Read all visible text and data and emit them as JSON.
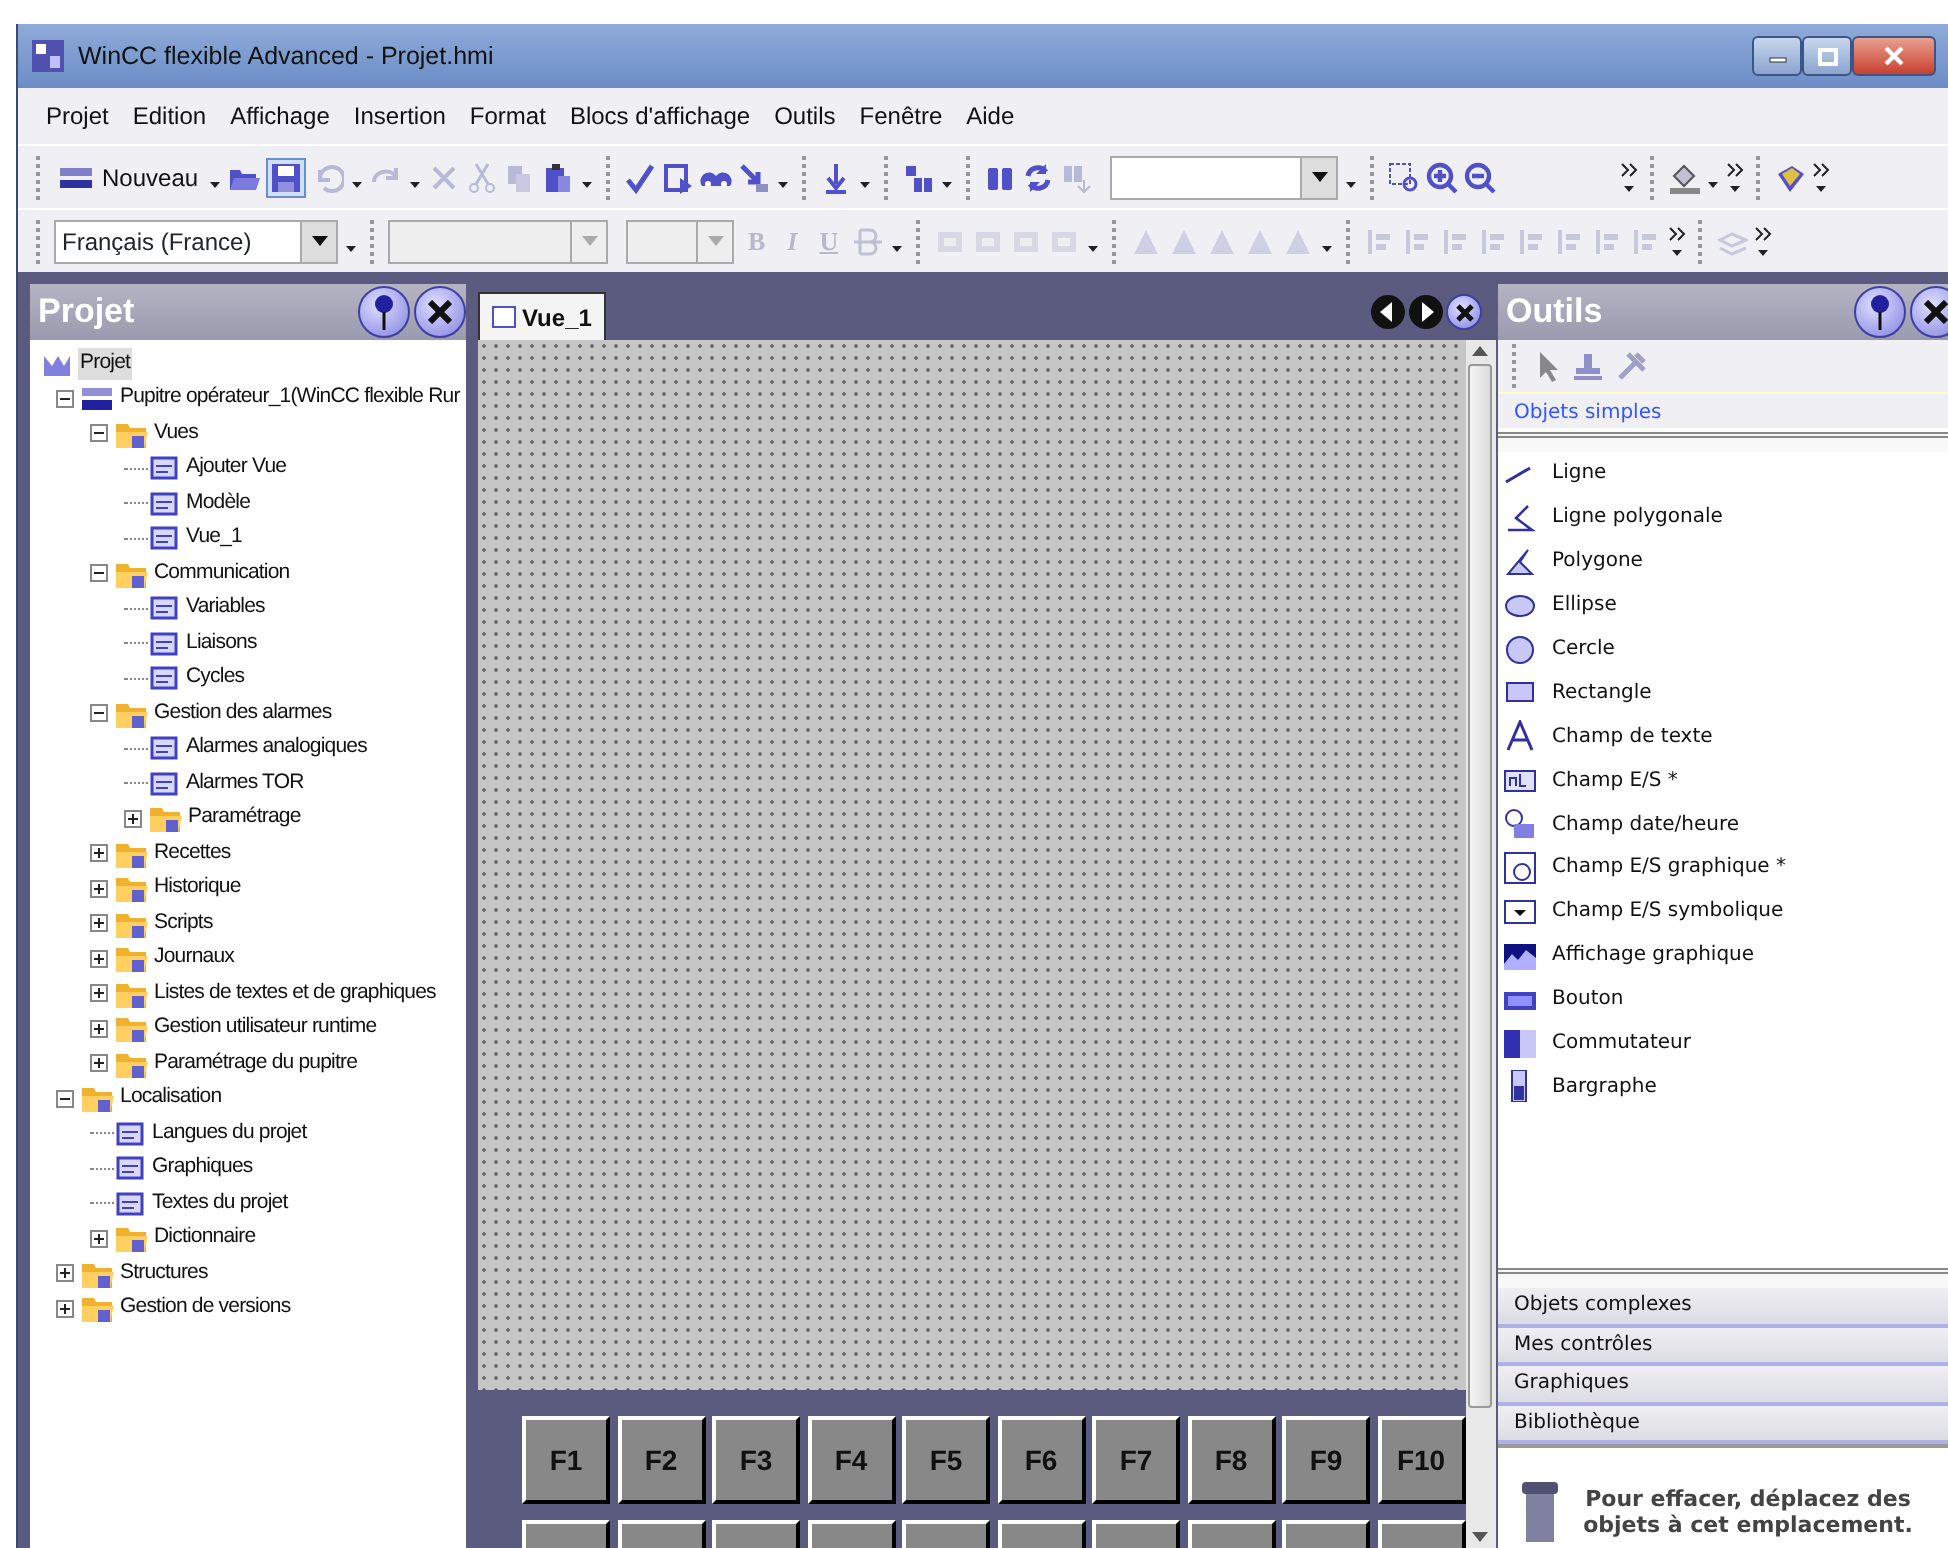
{
  "window": {
    "title": "WinCC flexible Advanced - Projet.hmi"
  },
  "menu": [
    "Projet",
    "Edition",
    "Affichage",
    "Insertion",
    "Format",
    "Blocs d'affichage",
    "Outils",
    "Fenêtre",
    "Aide"
  ],
  "toolbar": {
    "new_button": "Nouveau"
  },
  "format_bar": {
    "language": "Français (France)",
    "style_buttons": [
      "B",
      "I",
      "U"
    ]
  },
  "project_panel": {
    "title": "Projet",
    "tree": [
      {
        "label": "Projet",
        "selected": true,
        "children": [
          {
            "label": "Pupitre opérateur_1(WinCC flexible Rur",
            "selected": false,
            "expanded": true,
            "children": [
              {
                "label": "Vues",
                "selected": false,
                "expanded": true,
                "children": [
                  {
                    "label": "Ajouter Vue",
                    "selected": false
                  },
                  {
                    "label": "Modèle",
                    "selected": false
                  },
                  {
                    "label": "Vue_1",
                    "selected": false
                  }
                ]
              },
              {
                "label": "Communication",
                "selected": false,
                "expanded": true,
                "children": [
                  {
                    "label": "Variables",
                    "selected": false
                  },
                  {
                    "label": "Liaisons",
                    "selected": false
                  },
                  {
                    "label": "Cycles",
                    "selected": false
                  }
                ]
              },
              {
                "label": "Gestion des alarmes",
                "selected": false,
                "expanded": true,
                "children": [
                  {
                    "label": "Alarmes analogiques",
                    "selected": false
                  },
                  {
                    "label": "Alarmes TOR",
                    "selected": false
                  },
                  {
                    "label": "Paramétrage",
                    "selected": false,
                    "expanded": false
                  }
                ]
              },
              {
                "label": "Recettes",
                "selected": false,
                "expanded": false
              },
              {
                "label": "Historique",
                "selected": false,
                "expanded": false
              },
              {
                "label": "Scripts",
                "selected": false,
                "expanded": false
              },
              {
                "label": "Journaux",
                "selected": false,
                "expanded": false
              },
              {
                "label": "Listes de textes et de graphiques",
                "selected": false,
                "expanded": false
              },
              {
                "label": "Gestion utilisateur runtime",
                "selected": false,
                "expanded": false
              },
              {
                "label": "Paramétrage du pupitre",
                "selected": false,
                "expanded": false
              }
            ]
          },
          {
            "label": "Localisation",
            "selected": false,
            "expanded": true,
            "children": [
              {
                "label": "Langues du projet",
                "selected": false
              },
              {
                "label": "Graphiques",
                "selected": false
              },
              {
                "label": "Textes du projet",
                "selected": false
              },
              {
                "label": "Dictionnaire",
                "selected": false,
                "expanded": false
              }
            ]
          },
          {
            "label": "Structures",
            "selected": false,
            "expanded": false
          },
          {
            "label": "Gestion de versions",
            "selected": false,
            "expanded": false
          }
        ]
      }
    ]
  },
  "editor": {
    "tabs": [
      {
        "label": "Vue_1",
        "selected": true
      }
    ],
    "function_keys": [
      "F1",
      "F2",
      "F3",
      "F4",
      "F5",
      "F6",
      "F7",
      "F8",
      "F9",
      "F10"
    ]
  },
  "tools_panel": {
    "title": "Outils",
    "groups": [
      {
        "label": "Objets simples",
        "expanded": true,
        "items": [
          "Ligne",
          "Ligne polygonale",
          "Polygone",
          "Ellipse",
          "Cercle",
          "Rectangle",
          "Champ de texte",
          "Champ E/S *",
          "Champ date/heure",
          "Champ E/S graphique *",
          "Champ E/S symbolique",
          "Affichage graphique",
          "Bouton",
          "Commutateur",
          "Bargraphe"
        ]
      },
      {
        "label": "Objets complexes",
        "expanded": false
      },
      {
        "label": "Mes contrôles",
        "expanded": false
      },
      {
        "label": "Graphiques",
        "expanded": false
      },
      {
        "label": "Bibliothèque",
        "expanded": false
      }
    ],
    "drop_hint": "Pour effacer, déplacez des objets à cet emplacement."
  }
}
